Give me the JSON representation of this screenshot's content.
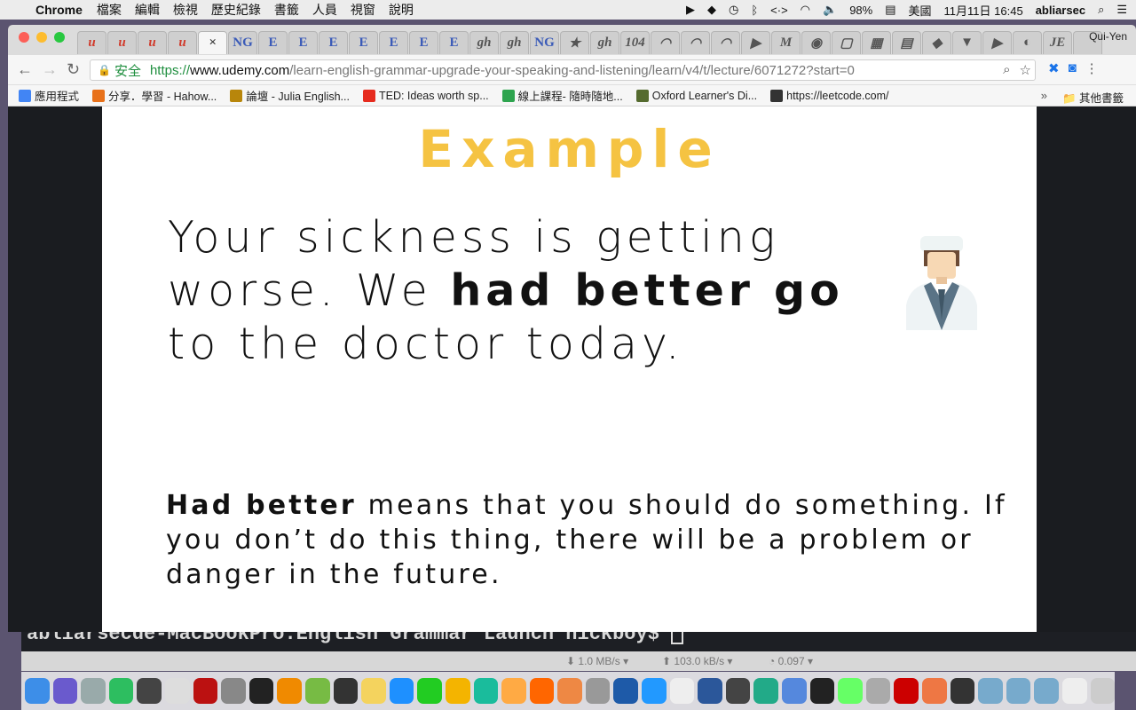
{
  "menubar": {
    "app_name": "Chrome",
    "menus": [
      "檔案",
      "編輯",
      "檢視",
      "歷史紀錄",
      "書籤",
      "人員",
      "視窗",
      "說明"
    ],
    "battery": "98%",
    "input_source": "美國",
    "datetime": "11月11日 16:45",
    "user": "abliarsec"
  },
  "browser": {
    "profile_name": "Qui-Yen",
    "active_tab_close": "×",
    "tab_favicons": [
      "u",
      "u",
      "u",
      "u",
      "×",
      "NG",
      "E",
      "E",
      "E",
      "E",
      "E",
      "E",
      "E",
      "gh",
      "gh",
      "NG",
      "★",
      "gh",
      "104",
      "◠",
      "◠",
      "◠",
      "▶",
      "M",
      "◉",
      "▢",
      "▦",
      "▤",
      "◆",
      "▼",
      "▶",
      "◐",
      "JE",
      ""
    ],
    "address": {
      "secure_label": "安全",
      "scheme": "https://",
      "host": "www.udemy.com",
      "path": "/learn-english-grammar-upgrade-your-speaking-and-listening/learn/v4/t/lecture/6071272?start=0"
    },
    "bookmarks": [
      {
        "label": "應用程式",
        "color": "#4285f4",
        "icon": "apps-icon"
      },
      {
        "label": "分享．學習 - Hahow...",
        "color": "#e8711a",
        "icon": "hahow-icon"
      },
      {
        "label": "論壇 - Julia English...",
        "color": "#b8860b",
        "icon": "julia-icon"
      },
      {
        "label": "TED: Ideas worth sp...",
        "color": "#e62b1e",
        "icon": "ted-icon"
      },
      {
        "label": "線上課程- 隨時隨地...",
        "color": "#2ea44f",
        "icon": "udemy-icon"
      },
      {
        "label": "Oxford Learner's Di...",
        "color": "#556b2f",
        "icon": "oxford-icon"
      },
      {
        "label": "https://leetcode.com/",
        "color": "#333333",
        "icon": "leetcode-icon"
      }
    ],
    "bookmarks_more": "»",
    "other_bookmarks": "其他書籤"
  },
  "slide": {
    "title": "Example",
    "sentence_part1": "Your sickness is getting worse. We ",
    "sentence_bold": "had better go",
    "sentence_part2": " to the doctor today.",
    "explain_bold": "Had better",
    "explain_rest": " means that you should do something. If you don’t do this thing, there will be a problem or danger in the future.",
    "title_color": "#f5c342"
  },
  "terminal": {
    "prompt": "abliarsecde-MacBookPro:English Grammar Launch nickboy$ "
  },
  "netbar": {
    "download": "⬇ 1.0 MB/s ▾",
    "upload": "⬆ 103.0 kB/s ▾",
    "other": "◔ 0.097 ▾"
  },
  "dock": {
    "apps": [
      "finder-icon",
      "siri-icon",
      "launchpad-icon",
      "evernote-icon",
      "mission-icon",
      "script-icon",
      "filezilla-icon",
      "prefs-icon",
      "terminal-icon",
      "vlc-icon",
      "tor-icon",
      "quicktime-icon",
      "notes-icon",
      "appstore-icon",
      "facetime-icon",
      "chrome-icon",
      "sourcetree-icon",
      "music-icon",
      "books-icon",
      "photos-icon",
      "db-icon",
      "virtualbox-icon",
      "wifi-icon",
      "preview-icon",
      "word-icon",
      "quicktime2-icon",
      "meter-icon",
      "audio-icon",
      "pycharm-icon",
      "atom-icon",
      "rocket-icon",
      "acrobat-icon",
      "ink-icon",
      "panda-icon",
      "folder1-icon",
      "folder2-icon",
      "folder3-icon",
      "paper-icon",
      "trash-icon"
    ],
    "colors": [
      "#3d8ee8",
      "#6a5acd",
      "#9aa",
      "#2dbe60",
      "#444",
      "#ddd",
      "#b11",
      "#888",
      "#222",
      "#f08a00",
      "#7b4",
      "#333",
      "#f4d35e",
      "#1e90ff",
      "#2c2",
      "#f4b400",
      "#1abc9c",
      "#fa4",
      "#f60",
      "#e84",
      "#999",
      "#1e5aa8",
      "#29f",
      "#eee",
      "#2b579a",
      "#444",
      "#2a8",
      "#58d",
      "#222",
      "#6f6",
      "#aaa",
      "#c00",
      "#e74",
      "#333",
      "#7ac",
      "#7ac",
      "#7ac",
      "#eee",
      "#ccc"
    ]
  }
}
